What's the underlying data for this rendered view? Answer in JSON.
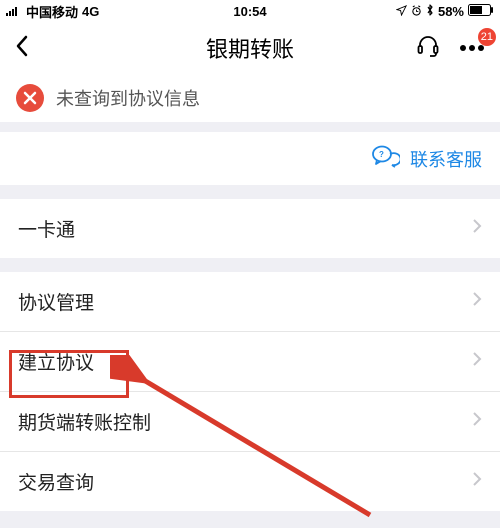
{
  "status": {
    "signal_icon": "signal-icon",
    "carrier": "中国移动",
    "network": "4G",
    "time": "10:54",
    "alarm_icon": "alarm-icon",
    "location_icon": "location-icon",
    "bluetooth_icon": "bluetooth-icon",
    "battery_pct": "58%",
    "battery_icon": "battery-icon"
  },
  "nav": {
    "back_icon": "chevron-left-icon",
    "title": "银期转账",
    "support_icon": "headset-icon",
    "more_icon": "more-icon",
    "badge": "21"
  },
  "error": {
    "icon": "close-icon",
    "message": "未查询到协议信息"
  },
  "support_link": {
    "icon": "chat-icon",
    "label": "联系客服"
  },
  "menu_group1": [
    {
      "label": "一卡通"
    }
  ],
  "menu_group2": [
    {
      "label": "协议管理"
    },
    {
      "label": "建立协议"
    },
    {
      "label": "期货端转账控制"
    },
    {
      "label": "交易查询"
    }
  ],
  "annotation": {
    "highlight_target": "建立协议"
  }
}
